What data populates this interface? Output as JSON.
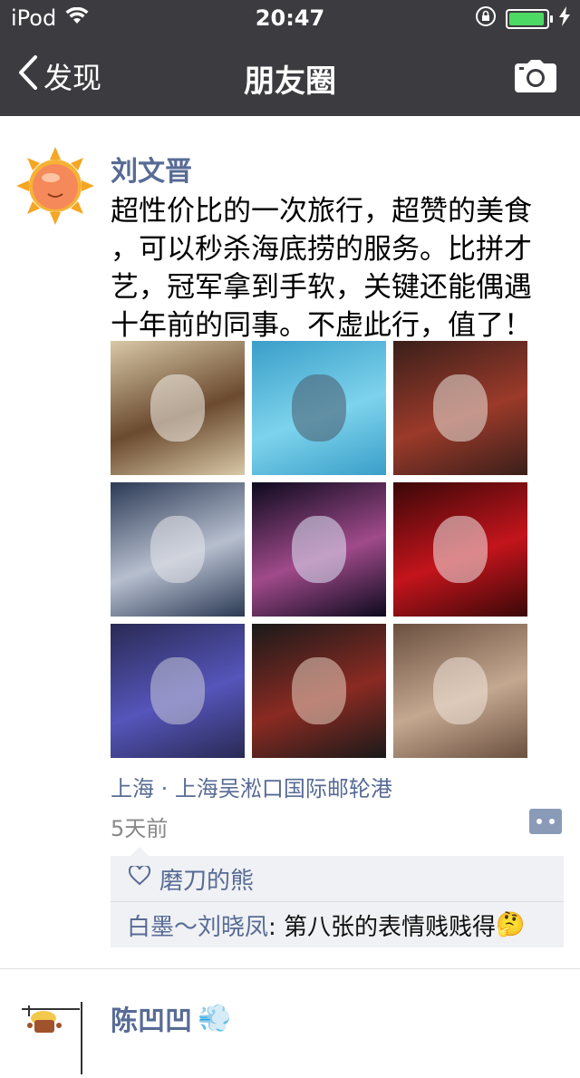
{
  "status": {
    "carrier": "iPod",
    "time": "20:47",
    "battery_level": 0.95,
    "icons": [
      "wifi-icon",
      "rotation-lock-icon",
      "battery-icon",
      "charging-bolt-icon"
    ]
  },
  "nav": {
    "back_label": "发现",
    "title": "朋友圈",
    "camera_icon": "camera-icon"
  },
  "post": {
    "author": "刘文晋",
    "lines": [
      "超性价比的一次旅行，超赞的美食",
      "，可以秒杀海底捞的服务。比拼才",
      "艺，冠军拿到手软，关键还能偶遇",
      "十年前的同事。不虚此行，值了！"
    ],
    "photos": [
      {
        "name": "girl-at-dinner-table-photo",
        "colors": [
          "#d8c8a8",
          "#6b4a2f",
          "#f4f1ea"
        ]
      },
      {
        "name": "swimming-pool-photo",
        "colors": [
          "#3a9ec9",
          "#7dd3ec",
          "#4a5a6a"
        ]
      },
      {
        "name": "roulette-chips-photo",
        "colors": [
          "#3a1f1a",
          "#9b3a2a",
          "#e9e3dd"
        ]
      },
      {
        "name": "girl-with-man-photo",
        "colors": [
          "#2c3a55",
          "#b7bfcf",
          "#e6e6ea"
        ]
      },
      {
        "name": "stage-show-photo",
        "colors": [
          "#0d0a1e",
          "#a04a8a",
          "#e0e6f8"
        ]
      },
      {
        "name": "red-stage-dancers-photo",
        "colors": [
          "#3a0808",
          "#c4141c",
          "#f0e8e8"
        ]
      },
      {
        "name": "two-men-with-trophy-photo",
        "colors": [
          "#2a2a55",
          "#5555bb",
          "#c8c8d8"
        ]
      },
      {
        "name": "group-selfie-photo",
        "colors": [
          "#1a1a1a",
          "#8a2a22",
          "#e8d0c0"
        ]
      },
      {
        "name": "dining-hall-photo",
        "colors": [
          "#6b5040",
          "#c4a890",
          "#f0e6dc"
        ]
      }
    ],
    "location": "上海 · 上海吴淞口国际邮轮港",
    "time": "5天前",
    "likes": {
      "icon": "heart-outline-icon",
      "names": "磨刀的熊"
    },
    "comments": [
      {
        "name": "白墨～刘晓凤",
        "text": ": 第八张的表情贱贱得",
        "emoji": "🤔"
      }
    ]
  },
  "post2": {
    "author": "陈凹凹",
    "emoji": "💨"
  },
  "colors": {
    "header_bg": "#3c3c40",
    "link": "#576b95",
    "comment_bg": "#f0f1f4"
  }
}
